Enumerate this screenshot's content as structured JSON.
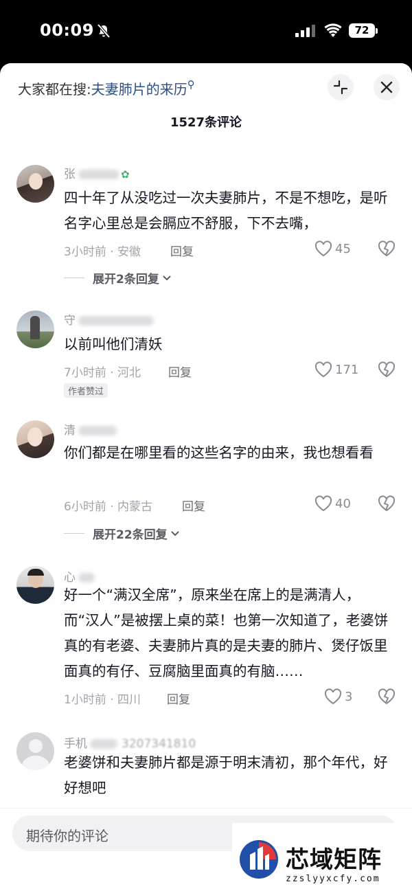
{
  "status_bar": {
    "time": "00:09",
    "battery": "72"
  },
  "header": {
    "search_prefix": "大家都在搜:",
    "search_term": "夫妻肺片的来历",
    "comment_count": "1527条评论"
  },
  "comments": [
    {
      "username": "张",
      "text": "四十年了从没吃过一次夫妻肺片，不是不想吃，是听名字心里总是会膈应不舒服，下不去嘴，",
      "meta": "3小时前 · 安徽",
      "reply": "回复",
      "likes": "45",
      "expand": "展开2条回复"
    },
    {
      "username": "守",
      "text": "以前叫他们清妖",
      "meta": "7小时前 · 河北",
      "reply": "回复",
      "likes": "171",
      "badge": "作者赞过"
    },
    {
      "username": "清",
      "text": "你们都是在哪里看的这些名字的由来，我也想看看",
      "meta": "6小时前 · 内蒙古",
      "reply": "回复",
      "likes": "40",
      "expand": "展开22条回复"
    },
    {
      "username": "心",
      "text": "好一个“满汉全席”，原来坐在席上的是满清人，而“汉人”是被摆上桌的菜！也第一次知道了，老婆饼真的有老婆、夫妻肺片真的是夫妻的肺片、煲仔饭里面真的有仔、豆腐脑里面真的有脑……",
      "meta": "1小时前 · 四川",
      "reply": "回复",
      "likes": "3"
    },
    {
      "username": "手机",
      "username_tail": "3207341810",
      "text": "老婆饼和夫妻肺片都是源于明末清初，那个年代，好好想吧"
    }
  ],
  "input": {
    "placeholder": "期待你的评论"
  },
  "watermark": {
    "title": "芯域矩阵",
    "url": "zzslyyxcfy.com"
  },
  "icons": [
    "bell-muted-icon",
    "signal-icon",
    "wifi-icon",
    "search-icon",
    "collapse-icon",
    "close-icon",
    "heart-icon",
    "broken-heart-icon",
    "chevron-down-icon"
  ],
  "colors": {
    "link": "#2b4f86",
    "text": "#161823",
    "meta": "#a3a3ab"
  }
}
